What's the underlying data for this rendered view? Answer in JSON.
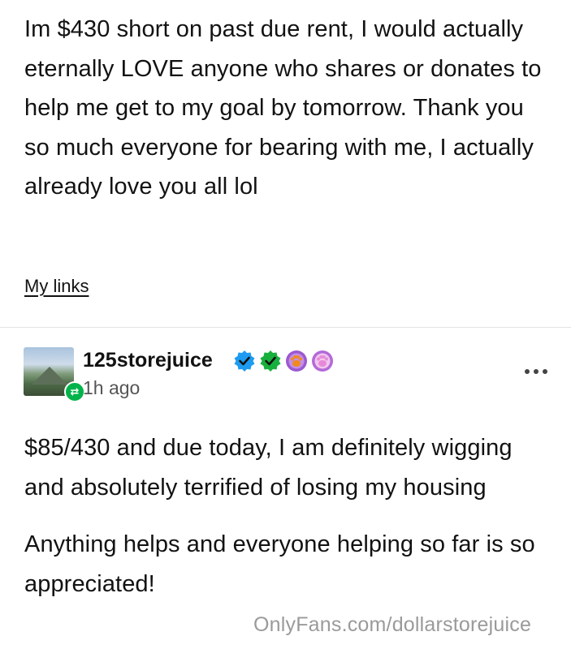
{
  "post": {
    "body": "Im $430 short on past due rent, I would actually eternally LOVE anyone who shares or donates to help me get to my goal by tomorrow. Thank you so much everyone for bearing with me, I actually already love you all lol",
    "links_label": "My links"
  },
  "reblog": {
    "username": "125storejuice",
    "timestamp": "1h ago",
    "badges": [
      "verified-blue-check-icon",
      "verified-green-check-icon",
      "paw-orange-icon",
      "paw-pink-icon"
    ],
    "paragraph1": "$85/430 and due today, I am definitely wigging and absolutely terrified of losing my housing",
    "paragraph2": "Anything helps and everyone helping so far is so appreciated!"
  },
  "watermark": "OnlyFans.com/dollarstorejuice",
  "colors": {
    "text": "#121212",
    "muted": "#555555",
    "reblog_green": "#00b34a",
    "verified_blue": "#1d9bf0",
    "verified_green": "#17b03d",
    "paw_purple": "#9b59d0",
    "paw_pink": "#e58ad8",
    "paw_orange": "#f08a1c",
    "watermark": "#9a9a9a"
  }
}
